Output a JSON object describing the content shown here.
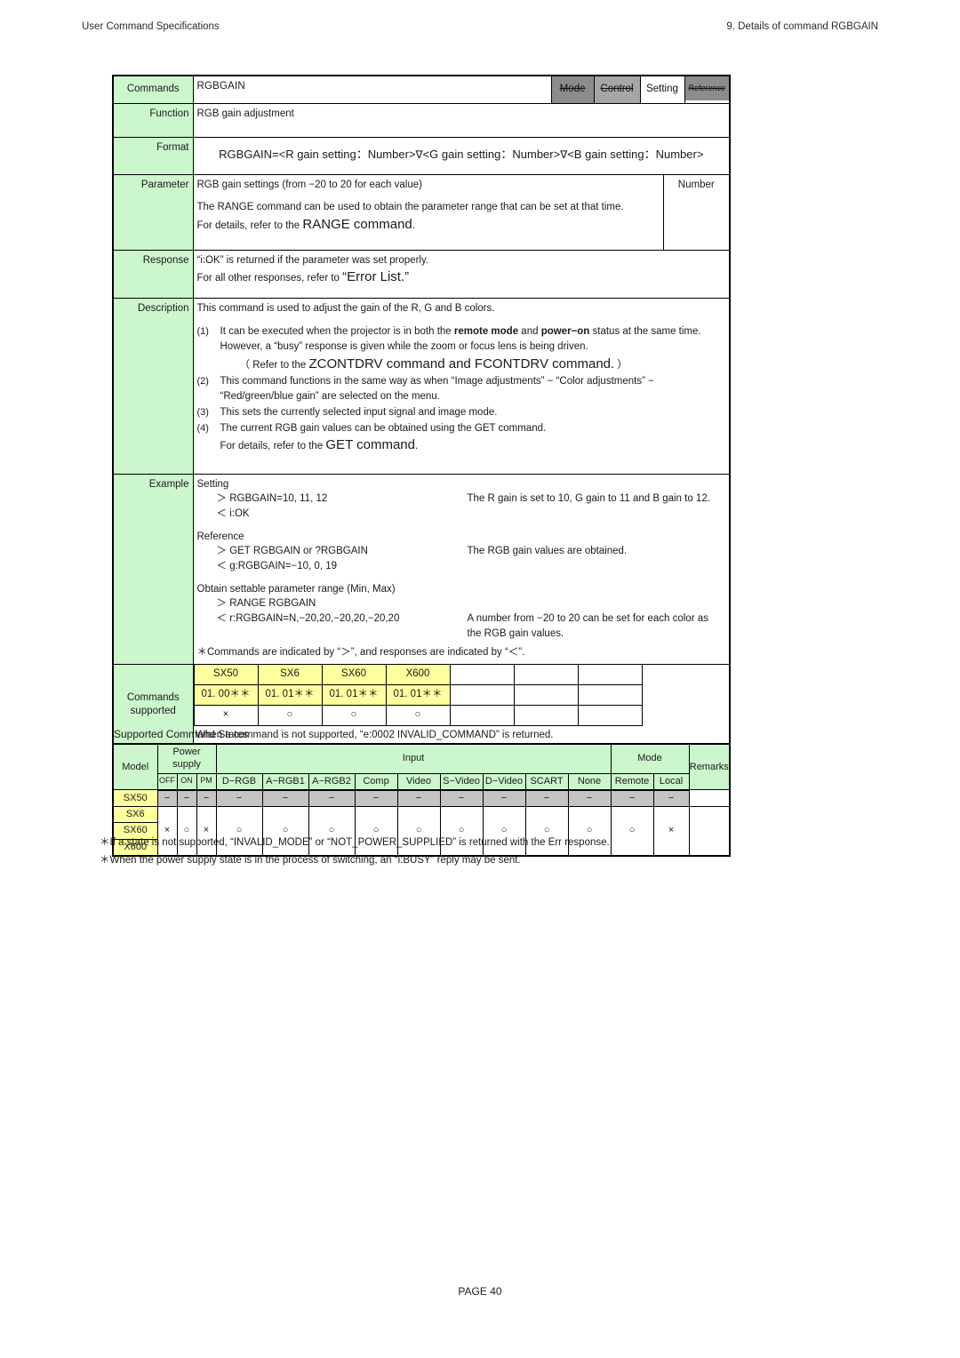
{
  "header": {
    "left": "User Command Specifications",
    "right": "9. Details of command  RGBGAIN"
  },
  "command_table": {
    "row_labels": {
      "commands": "Commands",
      "function": "Function",
      "format": "Format",
      "parameter": "Parameter",
      "response": "Response",
      "description": "Description",
      "example": "Example",
      "commands_supported_1": "Commands",
      "commands_supported_2": "supported"
    },
    "title": "RGBGAIN",
    "tabs": [
      {
        "label": "Mode",
        "state": "disabled"
      },
      {
        "label": "Control",
        "state": "disabled"
      },
      {
        "label": "Setting",
        "state": "active"
      },
      {
        "label": "Reference",
        "state": "disabled"
      }
    ],
    "function": "RGB gain adjustment",
    "format": {
      "prefix": "RGBGAIN=<R gain setting：Number>",
      "sep1": "∇",
      "mid": "<G gain setting：Number>",
      "sep2": "∇",
      "suffix": "<B gain setting：Number>"
    },
    "parameter": {
      "line1": "RGB gain settings (from −20 to 20 for each value)",
      "line2": "The RANGE command can be used to obtain the parameter range that can be set at that time.",
      "line3_pre": "For details, refer to the ",
      "line3_big": "RANGE command",
      "line3_post": ".",
      "type": "Number"
    },
    "response": {
      "line1": "“i:OK” is returned if the parameter was set properly.",
      "line2_pre": "For all other responses, refer to ",
      "line2_big": "“Error List.”"
    },
    "description": {
      "intro": "This command is used to adjust the gain of the R, G and B colors.",
      "items": [
        {
          "num": "(1)",
          "text_a": "It can be executed when the projector is in both the ",
          "bold_a": "remote mode",
          "text_b": " and ",
          "bold_b": "power−on",
          "text_c": " status at the same time.",
          "line2": "However, a “busy” response is given while the zoom or focus lens is being driven.",
          "line3_pre": "（ Refer to the ",
          "line3_big": "ZCONTDRV command and FCONTDRV command.",
          "line3_post": " ）"
        },
        {
          "num": "(2)",
          "text": "This command functions in the same way as when “Image adjustments” − “Color adjustments” − “Red/green/blue gain” are selected on the menu."
        },
        {
          "num": "(3)",
          "text": "This sets the currently selected input signal and image mode."
        },
        {
          "num": "(4)",
          "text": "The current RGB gain values can be obtained using the GET command.",
          "line2_pre": "For details, refer to the ",
          "line2_big": "GET command",
          "line2_post": "."
        }
      ]
    },
    "example": {
      "setting_label": "Setting",
      "setting_rows": [
        {
          "cmd": "＞ RGBGAIN=10, 11, 12",
          "desc": "The R gain is set to 10, G gain to 11 and B gain to 12."
        },
        {
          "cmd": "＜ i:OK",
          "desc": ""
        }
      ],
      "reference_label": "Reference",
      "reference_rows": [
        {
          "cmd": "＞ GET RGBGAIN or ?RGBGAIN",
          "desc": "The RGB gain values are obtained."
        },
        {
          "cmd": "＜ g:RGBGAIN=−10, 0, 19",
          "desc": ""
        }
      ],
      "range_label": "Obtain settable parameter range (Min, Max)",
      "range_rows": [
        {
          "cmd": "＞ RANGE RGBGAIN",
          "desc": ""
        },
        {
          "cmd": "＜ r:RGBGAIN=N,−20,20,−20,20,−20,20",
          "desc": "A number from −20 to 20 can be set for each color as the RGB gain values."
        }
      ],
      "note": "＊Commands are indicated by “＞”, and responses are indicated by “＜”."
    },
    "supported": {
      "models": [
        "SX50",
        "SX6",
        "SX60",
        "X600",
        "",
        "",
        "",
        ""
      ],
      "versions": [
        "01. 00＊＊",
        "01. 01＊＊",
        "01. 01＊＊",
        "01. 01＊＊",
        "",
        "",
        "",
        ""
      ],
      "marks": [
        "×",
        "○",
        "○",
        "○",
        "",
        "",
        "",
        ""
      ],
      "note": "When a command is not supported, “e:0002 INVALID_COMMAND” is returned."
    }
  },
  "states_table": {
    "title": "Supported Command States",
    "headers": {
      "model": "Model",
      "power_supply": "Power supply",
      "power_states": [
        "OFF",
        "ON",
        "PM"
      ],
      "input": "Input",
      "input_states": [
        "D−RGB",
        "A−RGB1",
        "A−RGB2",
        "Comp",
        "Video",
        "S−Video",
        "D−Video",
        "SCART",
        "None"
      ],
      "mode": "Mode",
      "mode_states": [
        "Remote",
        "Local"
      ],
      "remarks": "Remarks"
    },
    "rows": [
      {
        "models": [
          "SX50"
        ],
        "style": "disabled",
        "values": [
          "−",
          "−",
          "−",
          "−",
          "−",
          "−",
          "−",
          "−",
          "−",
          "−",
          "−",
          "−",
          "−",
          "−"
        ],
        "remarks": ""
      },
      {
        "models": [
          "SX6",
          "SX60",
          "X600"
        ],
        "style": "normal",
        "values": [
          "×",
          "○",
          "×",
          "○",
          "○",
          "○",
          "○",
          "○",
          "○",
          "○",
          "○",
          "○",
          "○",
          "×"
        ],
        "remarks": ""
      }
    ],
    "footnotes": [
      "＊If a state is not supported, “INVALID_MODE” or “NOT_POWER_SUPPLIED” is returned with the Err response.",
      "＊When the power supply state is in the process of switching, an “i:BUSY” reply may be sent."
    ]
  },
  "footer": {
    "page": "PAGE 40"
  },
  "colors": {
    "label_green": "#CCF6CC",
    "model_yellow": "#FFFF9E",
    "disabled_gray": "#C4C4C4",
    "tab_gray": "#8C8C8C"
  }
}
